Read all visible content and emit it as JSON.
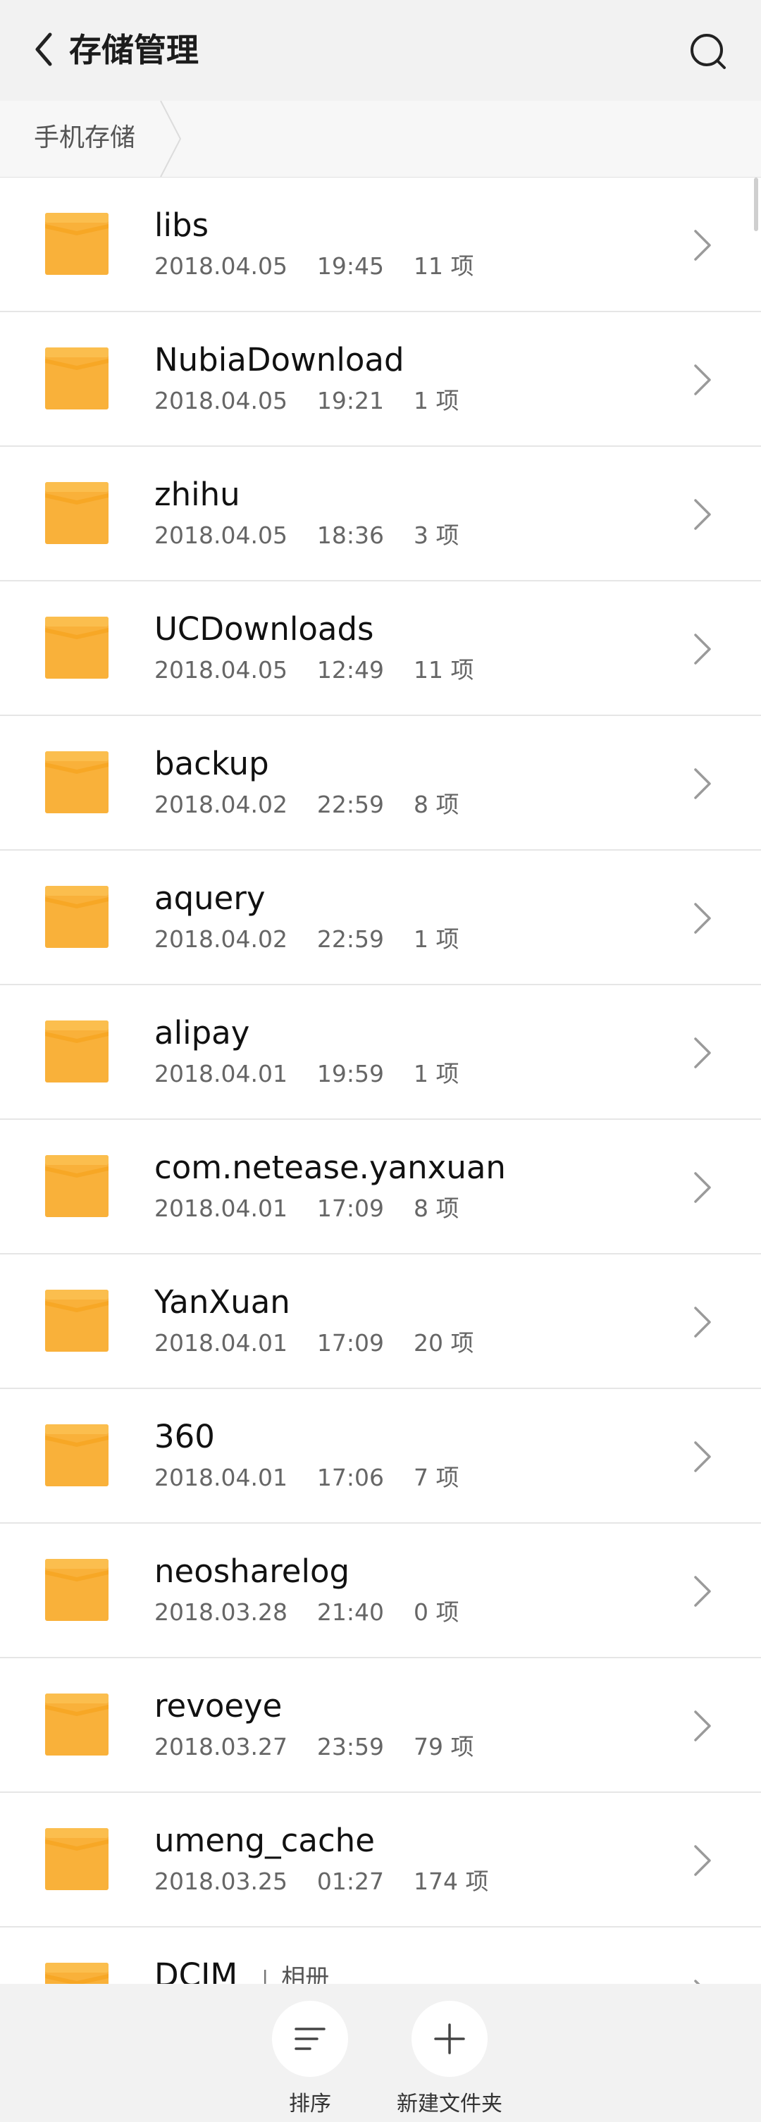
{
  "header": {
    "title": "存储管理"
  },
  "breadcrumb": {
    "current": "手机存储"
  },
  "folders": [
    {
      "name": "libs",
      "meta": "2018.04.05    19:45    11 项"
    },
    {
      "name": "NubiaDownload",
      "meta": "2018.04.05    19:21    1 项"
    },
    {
      "name": "zhihu",
      "meta": "2018.04.05    18:36    3 项"
    },
    {
      "name": "UCDownloads",
      "meta": "2018.04.05    12:49    11 项"
    },
    {
      "name": "backup",
      "meta": "2018.04.02    22:59    8 项"
    },
    {
      "name": "aquery",
      "meta": "2018.04.02    22:59    1 项"
    },
    {
      "name": "alipay",
      "meta": "2018.04.01    19:59    1 项"
    },
    {
      "name": "com.netease.yanxuan",
      "meta": "2018.04.01    17:09    8 项"
    },
    {
      "name": "YanXuan",
      "meta": "2018.04.01    17:09    20 项"
    },
    {
      "name": "360",
      "meta": "2018.04.01    17:06    7 项"
    },
    {
      "name": "neosharelog",
      "meta": "2018.03.28    21:40    0 项"
    },
    {
      "name": "revoeye",
      "meta": "2018.03.27    23:59    79 项"
    },
    {
      "name": "umeng_cache",
      "meta": "2018.03.25    01:27    174 项"
    },
    {
      "name": "DCIM",
      "separator": "|",
      "tag": "相册"
    }
  ],
  "toolbar": {
    "sort_label": "排序",
    "new_folder_label": "新建文件夹"
  },
  "colors": {
    "folder": "#F9B13A",
    "folder_dark": "#F6A623",
    "header_bg": "#F2F2F2",
    "divider": "#E6E6E6"
  }
}
